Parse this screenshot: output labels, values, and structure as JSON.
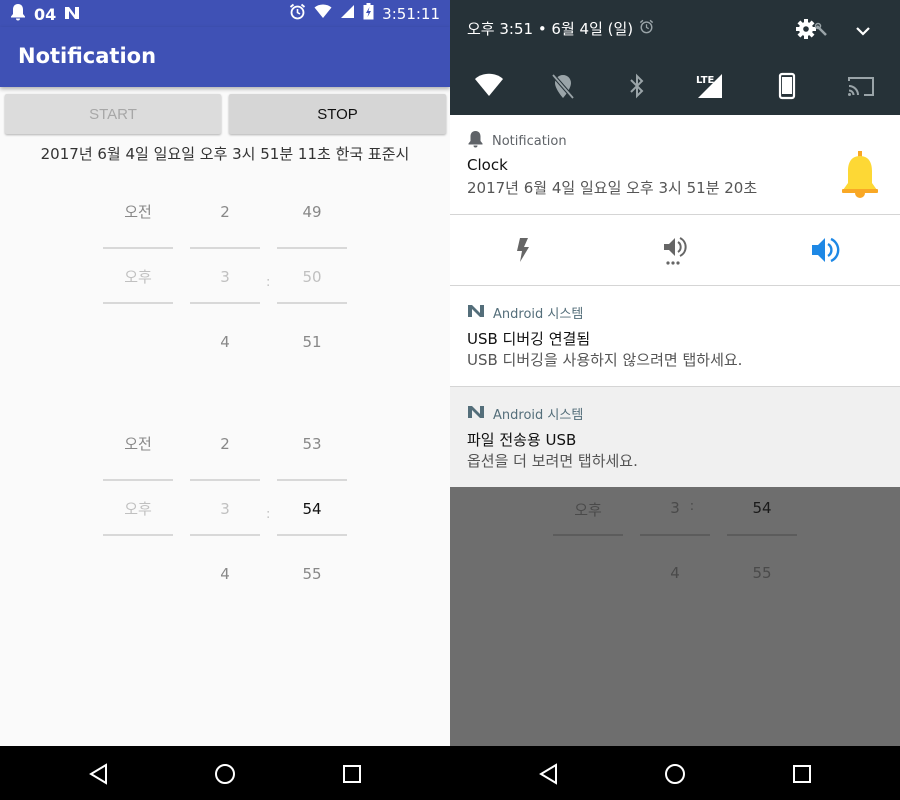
{
  "left": {
    "status_bar": {
      "notif_count": "04",
      "time": "3:51:11"
    },
    "app_title": "Notification",
    "buttons": {
      "start": "START",
      "stop": "STOP"
    },
    "current_datetime": "2017년 6월 4일 일요일 오후 3시 51분 11초 한국 표준시",
    "picker1": {
      "ampm": [
        "오전",
        "오후"
      ],
      "hours": [
        "2",
        "3",
        "4"
      ],
      "minutes": [
        "49",
        "50",
        "51"
      ],
      "separator": ":"
    },
    "picker2": {
      "ampm": [
        "오전",
        "오후"
      ],
      "hours": [
        "2",
        "3",
        "4"
      ],
      "minutes": [
        "53",
        "54",
        "55"
      ],
      "separator": ":"
    }
  },
  "right": {
    "date_line": "오후 3:51 • 6월 4일 (일)",
    "quick_settings": [
      "wifi-icon",
      "location-off-icon",
      "bluetooth-icon",
      "lte-signal-icon",
      "phone-icon",
      "cast-icon"
    ],
    "clock_notification": {
      "app_name": "Notification",
      "title": "Clock",
      "text": "2017년 6월 4일 일요일 오후 3시 51분 20초"
    },
    "sound_modes": [
      "flash-icon",
      "vibrate-sound-icon",
      "volume-icon"
    ],
    "usb_debug_notification": {
      "app_name": "Android 시스템",
      "title": "USB 디버깅 연결됨",
      "text": "USB 디버깅을 사용하지 않으려면 탭하세요."
    },
    "usb_transfer_notification": {
      "app_name": "Android 시스템",
      "title": "파일 전송용 USB",
      "text": "옵션을 더 보려면 탭하세요."
    },
    "behind_picker": {
      "ampm": "오후",
      "hours": [
        "3",
        "4"
      ],
      "minutes": [
        "54",
        "55"
      ],
      "separator": ":"
    }
  },
  "colors": {
    "primary": "#3f51b5",
    "shade_bg": "#263238",
    "accent_blue": "#1e88e5",
    "bell_yellow": "#fbc02d"
  }
}
